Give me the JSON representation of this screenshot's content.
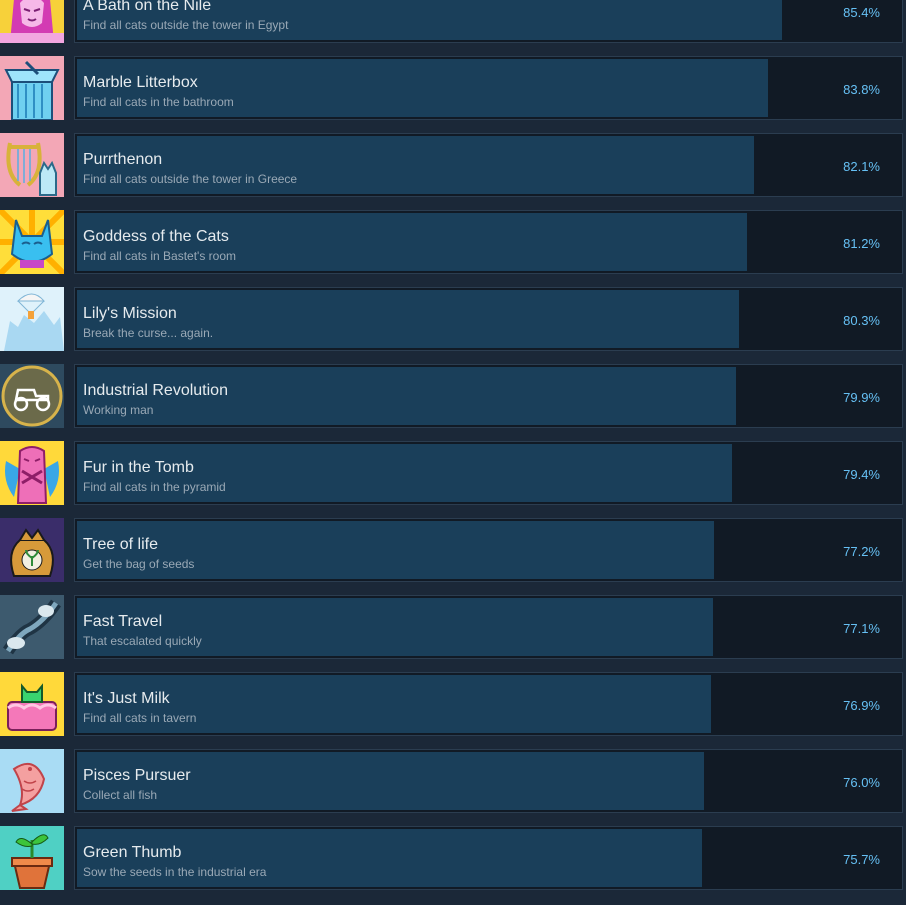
{
  "achievements": [
    {
      "title": "A Bath on the Nile",
      "description": "Find all cats outside the tower in Egypt",
      "percent": "85.4%",
      "value": 85.4,
      "icon": "sphinx-cat-icon"
    },
    {
      "title": "Marble Litterbox",
      "description": "Find all cats in the bathroom",
      "percent": "83.8%",
      "value": 83.8,
      "icon": "marble-litterbox-icon"
    },
    {
      "title": "Purrthenon",
      "description": "Find all cats outside the tower in Greece",
      "percent": "82.1%",
      "value": 82.1,
      "icon": "lyre-cat-icon"
    },
    {
      "title": "Goddess of the Cats",
      "description": "Find all cats in Bastet's room",
      "percent": "81.2%",
      "value": 81.2,
      "icon": "bastet-cat-icon"
    },
    {
      "title": "Lily's Mission",
      "description": "Break the curse... again.",
      "percent": "80.3%",
      "value": 80.3,
      "icon": "parachute-tower-icon"
    },
    {
      "title": "Industrial Revolution",
      "description": "Working man",
      "percent": "79.9%",
      "value": 79.9,
      "icon": "automobile-icon"
    },
    {
      "title": "Fur in the Tomb",
      "description": "Find all cats in the pyramid",
      "percent": "79.4%",
      "value": 79.4,
      "icon": "mummy-cat-icon"
    },
    {
      "title": "Tree of life",
      "description": "Get the bag of seeds",
      "percent": "77.2%",
      "value": 77.2,
      "icon": "seed-bag-icon"
    },
    {
      "title": "Fast Travel",
      "description": "That escalated quickly",
      "percent": "77.1%",
      "value": 77.1,
      "icon": "portal-icon"
    },
    {
      "title": "It's Just Milk",
      "description": "Find all cats in tavern",
      "percent": "76.9%",
      "value": 76.9,
      "icon": "cake-cat-icon"
    },
    {
      "title": "Pisces Pursuer",
      "description": "Collect all fish",
      "percent": "76.0%",
      "value": 76.0,
      "icon": "fish-icon"
    },
    {
      "title": "Green Thumb",
      "description": "Sow the seeds in the industrial era",
      "percent": "75.7%",
      "value": 75.7,
      "icon": "potted-sprout-icon"
    }
  ],
  "colors": {
    "page_bg": "#1b2838",
    "bar_bg": "#111a25",
    "bar_fill": "#1a3f5a",
    "percent_text": "#66c0f4"
  }
}
